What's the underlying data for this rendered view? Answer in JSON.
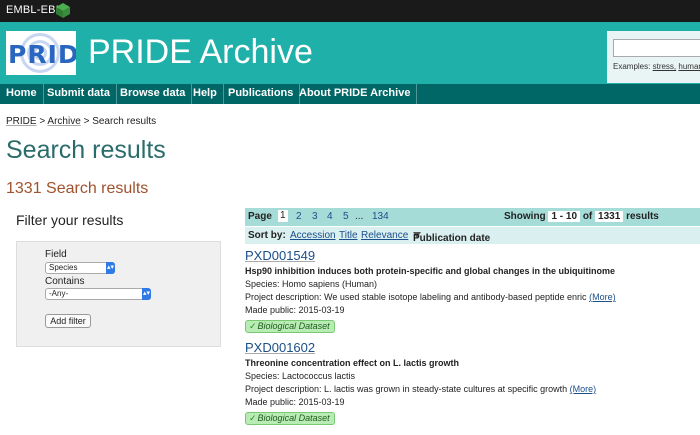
{
  "topbar": {
    "org": "EMBL-EBI"
  },
  "masthead": {
    "logo_text": "PRIDE",
    "title": "PRIDE Archive",
    "search": {
      "value": "",
      "examples_label": "Examples:",
      "examples": [
        "stress,",
        "human,"
      ]
    }
  },
  "nav": [
    "Home",
    "Submit data",
    "Browse data",
    "Help",
    "Publications",
    "About PRIDE Archive"
  ],
  "breadcrumb": {
    "items": [
      "PRIDE",
      "Archive"
    ],
    "current": "Search results",
    "sep": ">"
  },
  "page_title": "Search results",
  "results_count": "1331 Search results",
  "filter": {
    "title": "Filter your results",
    "field_label": "Field",
    "field_value": "Species",
    "contains_label": "Contains",
    "contains_value": "-Any-",
    "button": "Add filter"
  },
  "pager": {
    "label": "Page",
    "pages": [
      "1",
      "2",
      "3",
      "4",
      "5",
      "...",
      "134"
    ],
    "current": "1",
    "showing_label": "Showing",
    "range": "1 - 10",
    "of_label": "of",
    "total": "1331",
    "results_label": "results"
  },
  "sort": {
    "label": "Sort by:",
    "options": [
      "Accession",
      "Title",
      "Relevance"
    ],
    "active": "Publication date"
  },
  "results": [
    {
      "accession": "PXD001549",
      "title": "Hsp90 inhibition induces both protein-specific and global changes in the ubiquitinome",
      "species": "Species: Homo sapiens (Human)",
      "description": "Project description: We used stable isotope labeling and antibody-based peptide enric",
      "more": "(More)",
      "made_public": "Made public: 2015-03-19",
      "badge": "Biological Dataset"
    },
    {
      "accession": "PXD001602",
      "title": "Threonine concentration effect on L. lactis growth",
      "species": "Species: Lactococcus lactis",
      "description": "Project description: L. lactis was grown in steady-state cultures at specific growth",
      "more": "(More)",
      "made_public": "Made public: 2015-03-19",
      "badge": "Biological Dataset"
    }
  ],
  "colors": {
    "teal": "#1fb0aa",
    "nav": "#006666",
    "title": "#2a6b6b",
    "count": "#a0522d",
    "link": "#1b4f8a"
  }
}
